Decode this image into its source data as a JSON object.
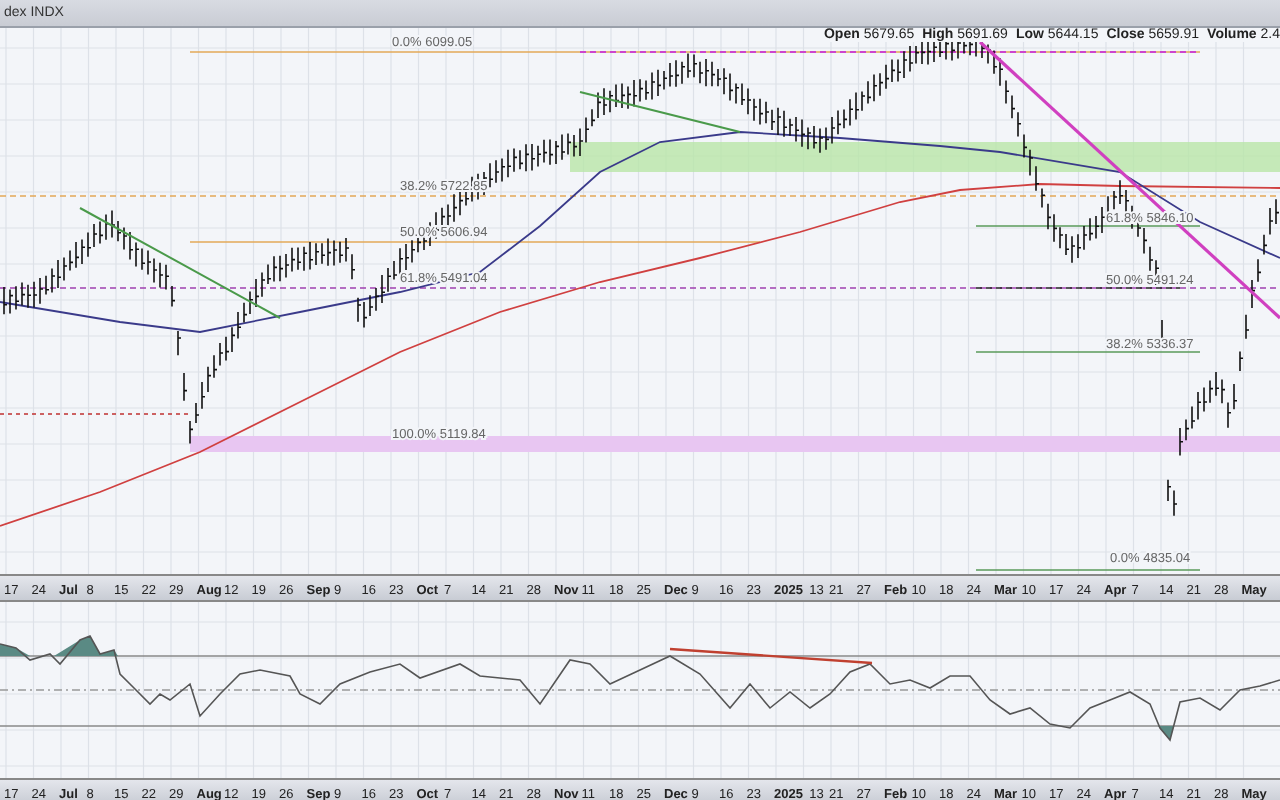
{
  "header": {
    "symbol": "dex INDX"
  },
  "quote": [
    {
      "label": "Open",
      "value": "5679.65"
    },
    {
      "label": "High",
      "value": "5691.69"
    },
    {
      "label": "Low",
      "value": "5644.15"
    },
    {
      "label": "Close",
      "value": "5659.91"
    },
    {
      "label": "Volume",
      "value": "2.4"
    }
  ],
  "main_panel": {
    "fib_labels": [
      {
        "text": "0.0% 6099.05"
      },
      {
        "text": "38.2% 5722.85"
      },
      {
        "text": "50.0% 5606.94"
      },
      {
        "text": "61.8% 5491.04"
      },
      {
        "text": "100.0% 5119.84"
      },
      {
        "text": "61.8% 5846.10"
      },
      {
        "text": "50.0% 5491.24"
      },
      {
        "text": "38.2% 5336.37"
      },
      {
        "text": "0.0% 4835.04"
      }
    ],
    "x_axis": [
      {
        "label": "17",
        "kind": "day"
      },
      {
        "label": "24",
        "kind": "day"
      },
      {
        "label": "Jul",
        "kind": "month"
      },
      {
        "label": "8",
        "kind": "day"
      },
      {
        "label": "15",
        "kind": "day"
      },
      {
        "label": "22",
        "kind": "day"
      },
      {
        "label": "29",
        "kind": "day"
      },
      {
        "label": "Aug",
        "kind": "month"
      },
      {
        "label": "12",
        "kind": "day"
      },
      {
        "label": "19",
        "kind": "day"
      },
      {
        "label": "26",
        "kind": "day"
      },
      {
        "label": "Sep",
        "kind": "month"
      },
      {
        "label": "9",
        "kind": "day"
      },
      {
        "label": "16",
        "kind": "day"
      },
      {
        "label": "23",
        "kind": "day"
      },
      {
        "label": "Oct",
        "kind": "month"
      },
      {
        "label": "7",
        "kind": "day"
      },
      {
        "label": "14",
        "kind": "day"
      },
      {
        "label": "21",
        "kind": "day"
      },
      {
        "label": "28",
        "kind": "day"
      },
      {
        "label": "Nov",
        "kind": "month"
      },
      {
        "label": "11",
        "kind": "day"
      },
      {
        "label": "18",
        "kind": "day"
      },
      {
        "label": "25",
        "kind": "day"
      },
      {
        "label": "Dec",
        "kind": "month"
      },
      {
        "label": "9",
        "kind": "day"
      },
      {
        "label": "16",
        "kind": "day"
      },
      {
        "label": "23",
        "kind": "day"
      },
      {
        "label": "2025",
        "kind": "month"
      },
      {
        "label": "13",
        "kind": "day"
      },
      {
        "label": "21",
        "kind": "day"
      },
      {
        "label": "27",
        "kind": "day"
      },
      {
        "label": "Feb",
        "kind": "month"
      },
      {
        "label": "10",
        "kind": "day"
      },
      {
        "label": "18",
        "kind": "day"
      },
      {
        "label": "24",
        "kind": "day"
      },
      {
        "label": "Mar",
        "kind": "month"
      },
      {
        "label": "10",
        "kind": "day"
      },
      {
        "label": "17",
        "kind": "day"
      },
      {
        "label": "24",
        "kind": "day"
      },
      {
        "label": "Apr",
        "kind": "month"
      },
      {
        "label": "7",
        "kind": "day"
      },
      {
        "label": "14",
        "kind": "day"
      },
      {
        "label": "21",
        "kind": "day"
      },
      {
        "label": "28",
        "kind": "day"
      },
      {
        "label": "May",
        "kind": "month"
      }
    ]
  },
  "indicator_panel": {
    "x_axis": [
      {
        "label": "17",
        "kind": "day"
      },
      {
        "label": "24",
        "kind": "day"
      },
      {
        "label": "Jul",
        "kind": "month"
      },
      {
        "label": "8",
        "kind": "day"
      },
      {
        "label": "15",
        "kind": "day"
      },
      {
        "label": "22",
        "kind": "day"
      },
      {
        "label": "29",
        "kind": "day"
      },
      {
        "label": "Aug",
        "kind": "month"
      },
      {
        "label": "12",
        "kind": "day"
      },
      {
        "label": "19",
        "kind": "day"
      },
      {
        "label": "26",
        "kind": "day"
      },
      {
        "label": "Sep",
        "kind": "month"
      },
      {
        "label": "9",
        "kind": "day"
      },
      {
        "label": "16",
        "kind": "day"
      },
      {
        "label": "23",
        "kind": "day"
      },
      {
        "label": "Oct",
        "kind": "month"
      },
      {
        "label": "7",
        "kind": "day"
      },
      {
        "label": "14",
        "kind": "day"
      },
      {
        "label": "21",
        "kind": "day"
      },
      {
        "label": "28",
        "kind": "day"
      },
      {
        "label": "Nov",
        "kind": "month"
      },
      {
        "label": "11",
        "kind": "day"
      },
      {
        "label": "18",
        "kind": "day"
      },
      {
        "label": "25",
        "kind": "day"
      },
      {
        "label": "Dec",
        "kind": "month"
      },
      {
        "label": "9",
        "kind": "day"
      },
      {
        "label": "16",
        "kind": "day"
      },
      {
        "label": "23",
        "kind": "day"
      },
      {
        "label": "2025",
        "kind": "month"
      },
      {
        "label": "13",
        "kind": "day"
      },
      {
        "label": "21",
        "kind": "day"
      },
      {
        "label": "27",
        "kind": "day"
      },
      {
        "label": "Feb",
        "kind": "month"
      },
      {
        "label": "10",
        "kind": "day"
      },
      {
        "label": "18",
        "kind": "day"
      },
      {
        "label": "24",
        "kind": "day"
      },
      {
        "label": "Mar",
        "kind": "month"
      },
      {
        "label": "10",
        "kind": "day"
      },
      {
        "label": "17",
        "kind": "day"
      },
      {
        "label": "24",
        "kind": "day"
      },
      {
        "label": "Apr",
        "kind": "month"
      },
      {
        "label": "7",
        "kind": "day"
      },
      {
        "label": "14",
        "kind": "day"
      },
      {
        "label": "21",
        "kind": "day"
      },
      {
        "label": "28",
        "kind": "day"
      },
      {
        "label": "May",
        "kind": "month"
      }
    ]
  }
}
